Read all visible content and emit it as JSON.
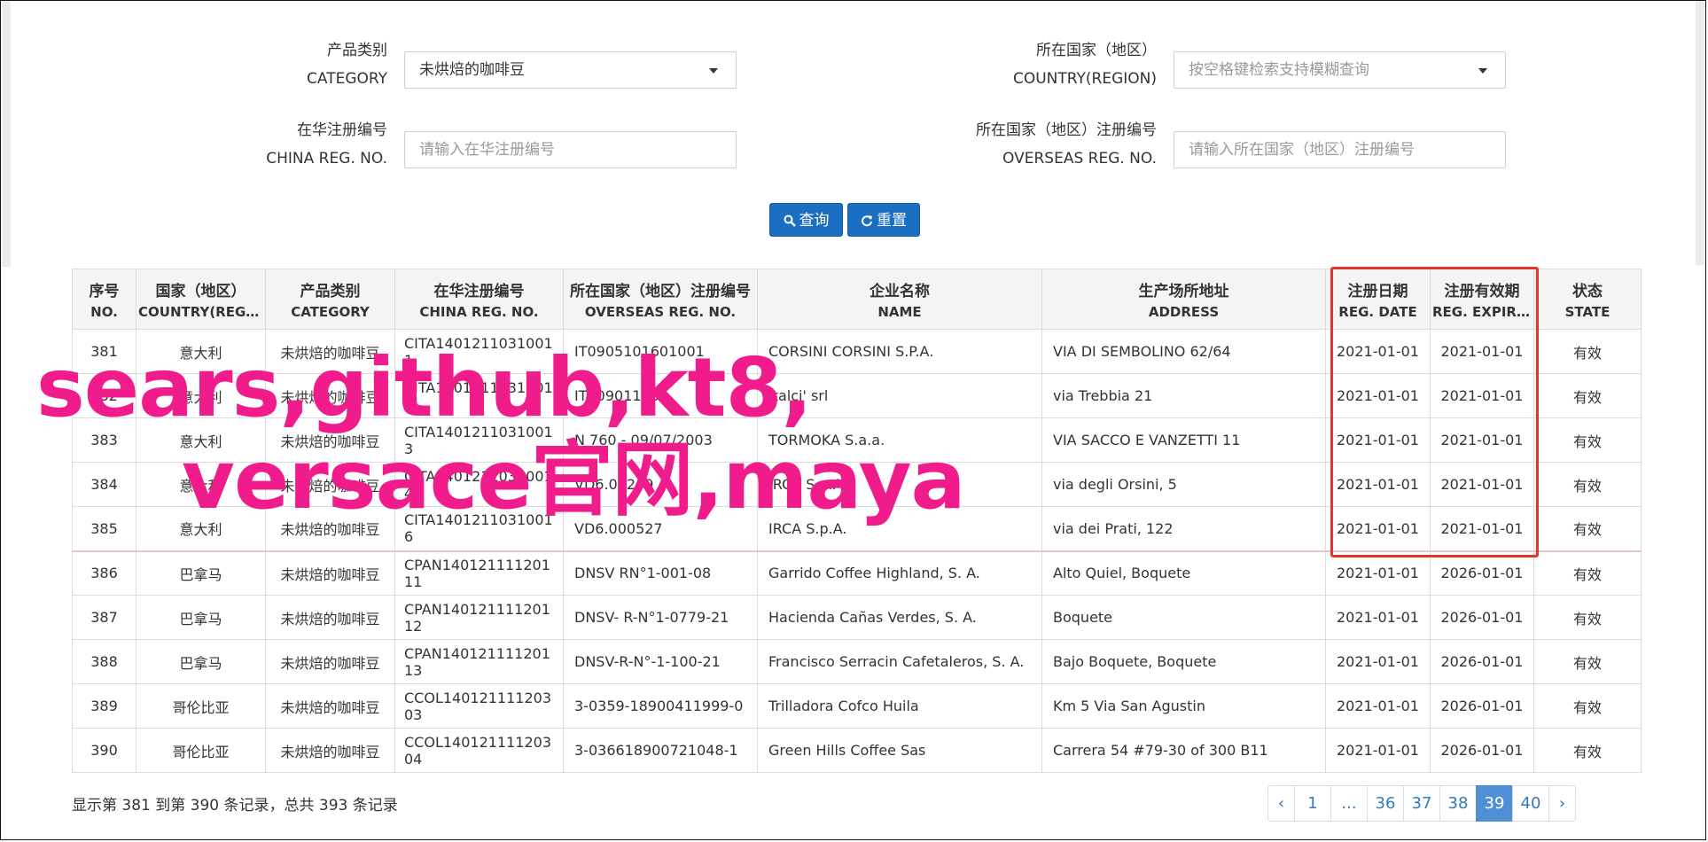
{
  "filters": {
    "category": {
      "label_cn": "产品类别",
      "label_en": "CATEGORY",
      "value": "未烘焙的咖啡豆"
    },
    "country": {
      "label_cn": "所在国家（地区）",
      "label_en": "COUNTRY(REGION)",
      "placeholder": "按空格键检索支持模糊查询"
    },
    "china_reg": {
      "label_cn": "在华注册编号",
      "label_en": "CHINA REG. NO.",
      "placeholder": "请输入在华注册编号"
    },
    "overseas_reg": {
      "label_cn": "所在国家（地区）注册编号",
      "label_en": "OVERSEAS REG. NO.",
      "placeholder": "请输入所在国家（地区）注册编号"
    },
    "search_label": "查询",
    "reset_label": "重置"
  },
  "table": {
    "columns": [
      {
        "cn": "序号",
        "en": "NO."
      },
      {
        "cn": "国家（地区）",
        "en": "COUNTRY(REGIO..."
      },
      {
        "cn": "产品类别",
        "en": "CATEGORY"
      },
      {
        "cn": "在华注册编号",
        "en": "CHINA REG. NO."
      },
      {
        "cn": "所在国家（地区）注册编号",
        "en": "OVERSEAS REG. NO."
      },
      {
        "cn": "企业名称",
        "en": "NAME"
      },
      {
        "cn": "生产场所地址",
        "en": "ADDRESS"
      },
      {
        "cn": "注册日期",
        "en": "REG. DATE"
      },
      {
        "cn": "注册有效期",
        "en": "REG. EXPIRE ..."
      },
      {
        "cn": "状态",
        "en": "STATE"
      }
    ],
    "rows": [
      [
        "381",
        "意大利",
        "未烘焙的咖啡豆",
        "CITA14012110310011",
        "IT0905101601001",
        "CORSINI CORSINI S.P.A.",
        "VIA DI SEMBOLINO 62/64",
        "2021-01-01",
        "2021-01-01",
        "有效"
      ],
      [
        "382",
        "意大利",
        "未烘焙的咖啡豆",
        "CITA14012110310012",
        "IT20901100",
        "Italci' srl",
        "via Trebbia 21",
        "2021-01-01",
        "2021-01-01",
        "有效"
      ],
      [
        "383",
        "意大利",
        "未烘焙的咖啡豆",
        "CITA14012110310013",
        "N 760 - 09/07/2003",
        "TORMOKA S.a.a.",
        "VIA SACCO E VANZETTI 11",
        "2021-01-01",
        "2021-01-01",
        "有效"
      ],
      [
        "384",
        "意大利",
        "未烘焙的咖啡豆",
        "CITA14012110310014",
        "VD6.00269",
        "IRCA S.p.A.",
        "via degli Orsini, 5",
        "2021-01-01",
        "2021-01-01",
        "有效"
      ],
      [
        "385",
        "意大利",
        "未烘焙的咖啡豆",
        "CITA14012110310016",
        "VD6.000527",
        "IRCA S.p.A.",
        "via dei Prati, 122",
        "2021-01-01",
        "2021-01-01",
        "有效"
      ],
      [
        "386",
        "巴拿马",
        "未烘焙的咖啡豆",
        "CPAN14012111120111",
        "DNSV RN°1-001-08",
        "Garrido Coffee Highland, S. A.",
        "Alto Quiel, Boquete",
        "2021-01-01",
        "2026-01-01",
        "有效"
      ],
      [
        "387",
        "巴拿马",
        "未烘焙的咖啡豆",
        "CPAN14012111120112",
        "DNSV- R-N°1-0779-21",
        "Hacienda Cañas Verdes, S. A.",
        "Boquete",
        "2021-01-01",
        "2026-01-01",
        "有效"
      ],
      [
        "388",
        "巴拿马",
        "未烘焙的咖啡豆",
        "CPAN14012111120113",
        "DNSV-R-N°-1-100-21",
        "Francisco Serracin Cafetaleros, S. A.",
        "Bajo Boquete, Boquete",
        "2021-01-01",
        "2026-01-01",
        "有效"
      ],
      [
        "389",
        "哥伦比亚",
        "未烘焙的咖啡豆",
        "CCOL14012111120303",
        "3-0359-18900411999-0",
        "Trilladora Cofco Huila",
        "Km 5 Via San Agustin",
        "2021-01-01",
        "2026-01-01",
        "有效"
      ],
      [
        "390",
        "哥伦比亚",
        "未烘焙的咖啡豆",
        "CCOL14012111120304",
        "3-036618900721048-1",
        "Green Hills Coffee Sas",
        "Carrera 54 #79-30 of 300 B11",
        "2021-01-01",
        "2026-01-01",
        "有效"
      ]
    ]
  },
  "summary": "显示第 381 到第 390 条记录，总共 393 条记录",
  "pagination": [
    "‹",
    "1",
    "...",
    "36",
    "37",
    "38",
    "39",
    "40",
    "›"
  ],
  "pagination_active": "39",
  "watermark": {
    "line1": "sears,github,kt8,",
    "line2": "versace官网,maya"
  },
  "colors": {
    "primary": "#1b6fc2",
    "highlight": "#e8322a",
    "watermark": "#f01c8c",
    "page_active": "#4f8fd6"
  }
}
